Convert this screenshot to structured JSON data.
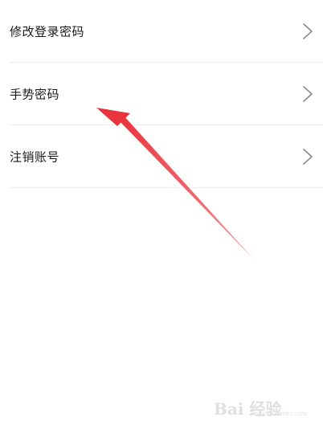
{
  "settings": {
    "items": [
      {
        "label": "修改登录密码",
        "icon": "chevron-right-icon"
      },
      {
        "label": "手势密码",
        "icon": "chevron-right-icon"
      },
      {
        "label": "注销账号",
        "icon": "chevron-right-icon"
      }
    ]
  },
  "annotation": {
    "arrow_color": "#e8343c"
  },
  "watermark": {
    "brand": "Bai 经验",
    "sub": "经验",
    "url": "jingyan.baidu.com"
  },
  "colors": {
    "text": "#1a1a1a",
    "divider": "#ececec",
    "chevron": "#888888"
  }
}
